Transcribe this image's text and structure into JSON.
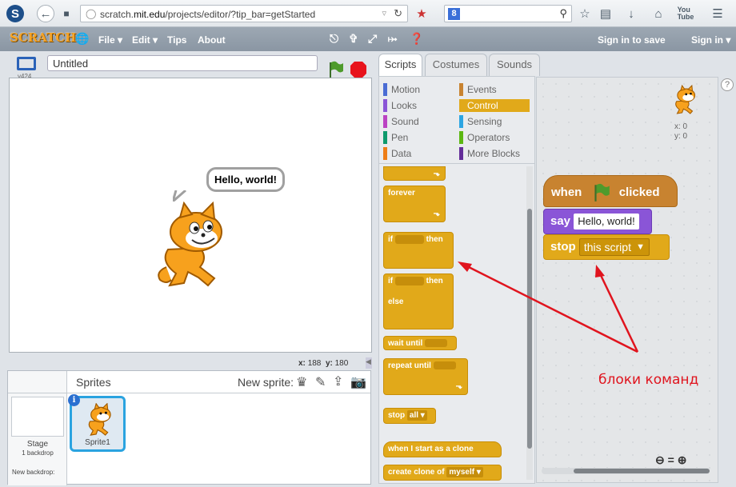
{
  "browser": {
    "url_prefix": "scratch.",
    "url_domain": "mit.edu",
    "url_path": "/projects/editor/?tip_bar=getStarted",
    "search_engine": "8"
  },
  "menu": {
    "logo": "SCRATCH",
    "file": "File ▾",
    "edit": "Edit ▾",
    "tips": "Tips",
    "about": "About",
    "sign_in_save": "Sign in to save",
    "sign_in": "Sign in ▾"
  },
  "project": {
    "title": "Untitled",
    "version": "v424"
  },
  "stage": {
    "bubble": "Hello, world!",
    "x_label": "x:",
    "x_value": "188",
    "y_label": "y:",
    "y_value": "180"
  },
  "sprites": {
    "header": "Sprites",
    "new_sprite": "New sprite:",
    "stage_label": "Stage",
    "stage_sub": "1 backdrop",
    "new_backdrop": "New backdrop:",
    "sprite1": "Sprite1"
  },
  "tabs": {
    "scripts": "Scripts",
    "costumes": "Costumes",
    "sounds": "Sounds"
  },
  "categories": {
    "motion": "Motion",
    "looks": "Looks",
    "sound": "Sound",
    "pen": "Pen",
    "data": "Data",
    "events": "Events",
    "control": "Control",
    "sensing": "Sensing",
    "operators": "Operators",
    "more": "More Blocks"
  },
  "palette": {
    "forever": "forever",
    "if": "if",
    "then": "then",
    "if2": "if",
    "then2": "then",
    "else": "else",
    "wait": "wait until",
    "repeat": "repeat until",
    "stop": "stop",
    "stop_opt": "all ▾",
    "clone_start": "when I start as a clone",
    "create_clone": "create clone of",
    "clone_opt": "myself ▾"
  },
  "script": {
    "when": "when",
    "clicked": "clicked",
    "say": "say",
    "say_value": "Hello, world!",
    "stop": "stop",
    "stop_value": "this script",
    "sprite_x": "x: 0",
    "sprite_y": "y: 0"
  },
  "annotation": "блоки команд",
  "colors": {
    "control": "#e1a91a",
    "looks": "#8a55d7",
    "events": "#c88330",
    "annotation": "#e0141e"
  }
}
